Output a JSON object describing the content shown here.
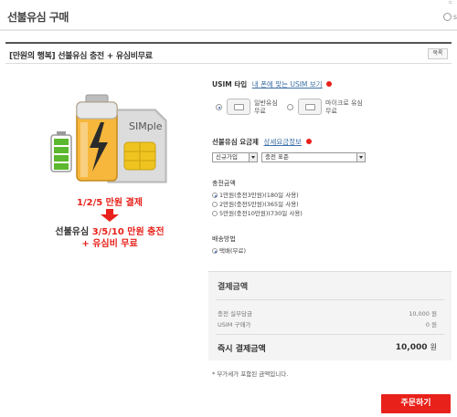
{
  "header": {
    "title": "선불유심 구매",
    "right_text": "s",
    "top_cut_text": "ㄷ"
  },
  "product": {
    "name": "[만원의 행복] 선불유심 충전 + 유심비무료",
    "list_button": "목록",
    "image_label": "SIMple",
    "promo_line1": "1/2/5 만원 결제",
    "promo_line2_prefix": "선불유심 ",
    "promo_line2_highlight": "3/5/10 만원 충전",
    "promo_line3": "+ 유심비 무료"
  },
  "usim_type": {
    "label": "USIM 타입",
    "link": "내 폰에 맞는 USIM 보기",
    "options": [
      {
        "label_line1": "일반유심",
        "label_line2": "무료",
        "selected": true
      },
      {
        "label_line1": "마이크로 유심",
        "label_line2": "무료",
        "selected": false
      }
    ]
  },
  "plan": {
    "label": "선불유심 요금제",
    "link": "상세요금정보",
    "select1": "신규가입",
    "select2": "충전 표준"
  },
  "charge": {
    "label": "충전금액",
    "options": [
      {
        "text": "1만원(충전3만원)(180일 사용)",
        "selected": true
      },
      {
        "text": "2만원(충전5만원)(365일 사용)",
        "selected": false
      },
      {
        "text": "5만원(충전10만원)(730일 사용)",
        "selected": false
      }
    ]
  },
  "delivery": {
    "label": "배송방법",
    "option": "택배(무료)"
  },
  "summary": {
    "title": "결제금액",
    "rows": [
      {
        "label": "충전 실부담금",
        "value": "10,000 원"
      },
      {
        "label": "USIM 구매가",
        "value": "0 원"
      }
    ],
    "total_label": "즉시 결제금액",
    "total_value": "10,000",
    "total_unit": "원"
  },
  "note": "* 부가세가 포함된 금액입니다.",
  "order_button": "주문하기",
  "colors": {
    "accent": "#e8211a",
    "link": "#3a6ea5",
    "battery_green": "#5cb82e",
    "battery_orange": "#f28a10"
  }
}
